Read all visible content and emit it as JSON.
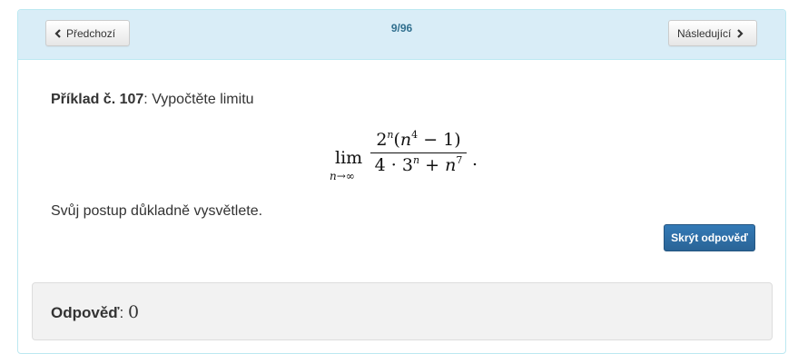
{
  "nav": {
    "prev_label": "Předchozí",
    "next_label": "Následující",
    "counter": "9/96",
    "prev_icon": "chevron-left-icon",
    "next_icon": "chevron-right-icon"
  },
  "problem": {
    "heading": "Příklad č. 107",
    "separator": ": ",
    "prompt": "Vypočtěte limitu",
    "instruction": "Svůj postup důkladně vysvětlete."
  },
  "formula": {
    "operator": "lim",
    "subscript": "n→∞",
    "numerator_base": "2",
    "numerator_exp": "n",
    "numerator_paren_open": "(",
    "numerator_var": "n",
    "numerator_var_exp": "4",
    "numerator_rest": " − 1)",
    "denominator_lead": "4 · 3",
    "denominator_exp": "n",
    "denominator_mid": " + ",
    "denominator_var": "n",
    "denominator_var_exp": "7",
    "trailing": "."
  },
  "toggle": {
    "label": "Skrýt odpověď"
  },
  "answer": {
    "label": "Odpověď",
    "separator": ": ",
    "value": "0"
  },
  "colors": {
    "heading_bg": "#d9edf7",
    "heading_border": "#bce8f1",
    "counter_text": "#31708f",
    "primary_button": "#337ab7",
    "answer_bg": "#f2f2f2"
  }
}
